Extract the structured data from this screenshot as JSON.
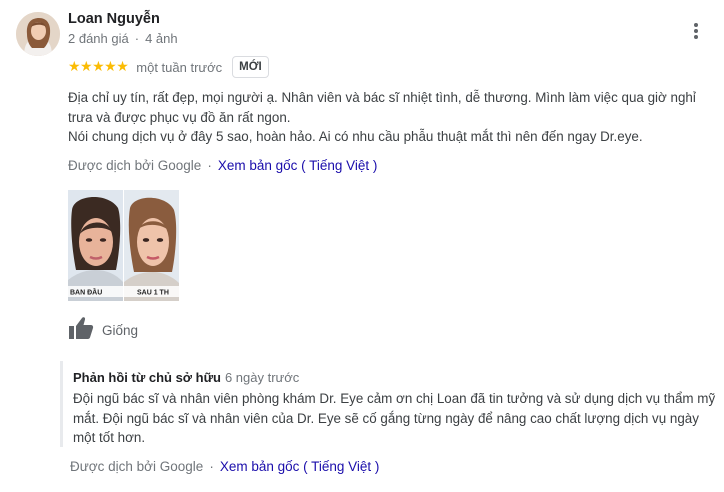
{
  "reviewer": {
    "name": "Loan Nguyễn",
    "reviews_count": "2 đánh giá",
    "photos_count": "4 ảnh"
  },
  "review": {
    "rating": 5,
    "stars": "★★★★★",
    "time": "một tuần trước",
    "badge": "MỚI",
    "text_lines": [
      "Địa chỉ uy tín, rất đẹp, mọi người ạ. Nhân viên và bác sĩ nhiệt tình, dễ thương. Mình làm việc qua giờ nghỉ trưa và được phục vụ đồ ăn rất ngon.",
      "Nói chung dịch vụ ở đây 5 sao, hoàn hảo. Ai có nhu cầu phẫu thuật mắt thì nên đến ngay Dr.eye."
    ],
    "translated_by": "Được dịch bởi Google",
    "view_original": "Xem bản gốc ( Tiếng Việt )",
    "photos": [
      {
        "caption": "BAN ĐẦU"
      },
      {
        "caption": "SAU 1 TH"
      }
    ],
    "like_label": "Giống"
  },
  "owner_reply": {
    "title": "Phản hồi từ chủ sở hữu",
    "time": "6 ngày trước",
    "text": "Đội ngũ bác sĩ và nhân viên phòng khám Dr. Eye cảm ơn chị Loan đã tin tưởng và sử dụng dịch vụ thẩm mỹ mắt. Đội ngũ bác sĩ và nhân viên của Dr. Eye sẽ cố gắng từng ngày để nâng cao chất lượng dịch vụ ngày một tốt hơn.",
    "translated_by": "Được dịch bởi Google",
    "view_original": "Xem bản gốc ( Tiếng Việt )"
  },
  "colors": {
    "star": "#fbbc04",
    "link": "#1a0dab",
    "secondary_text": "#70757a"
  },
  "icons": {
    "more": "more-vert-icon",
    "like": "thumb-up-icon"
  }
}
